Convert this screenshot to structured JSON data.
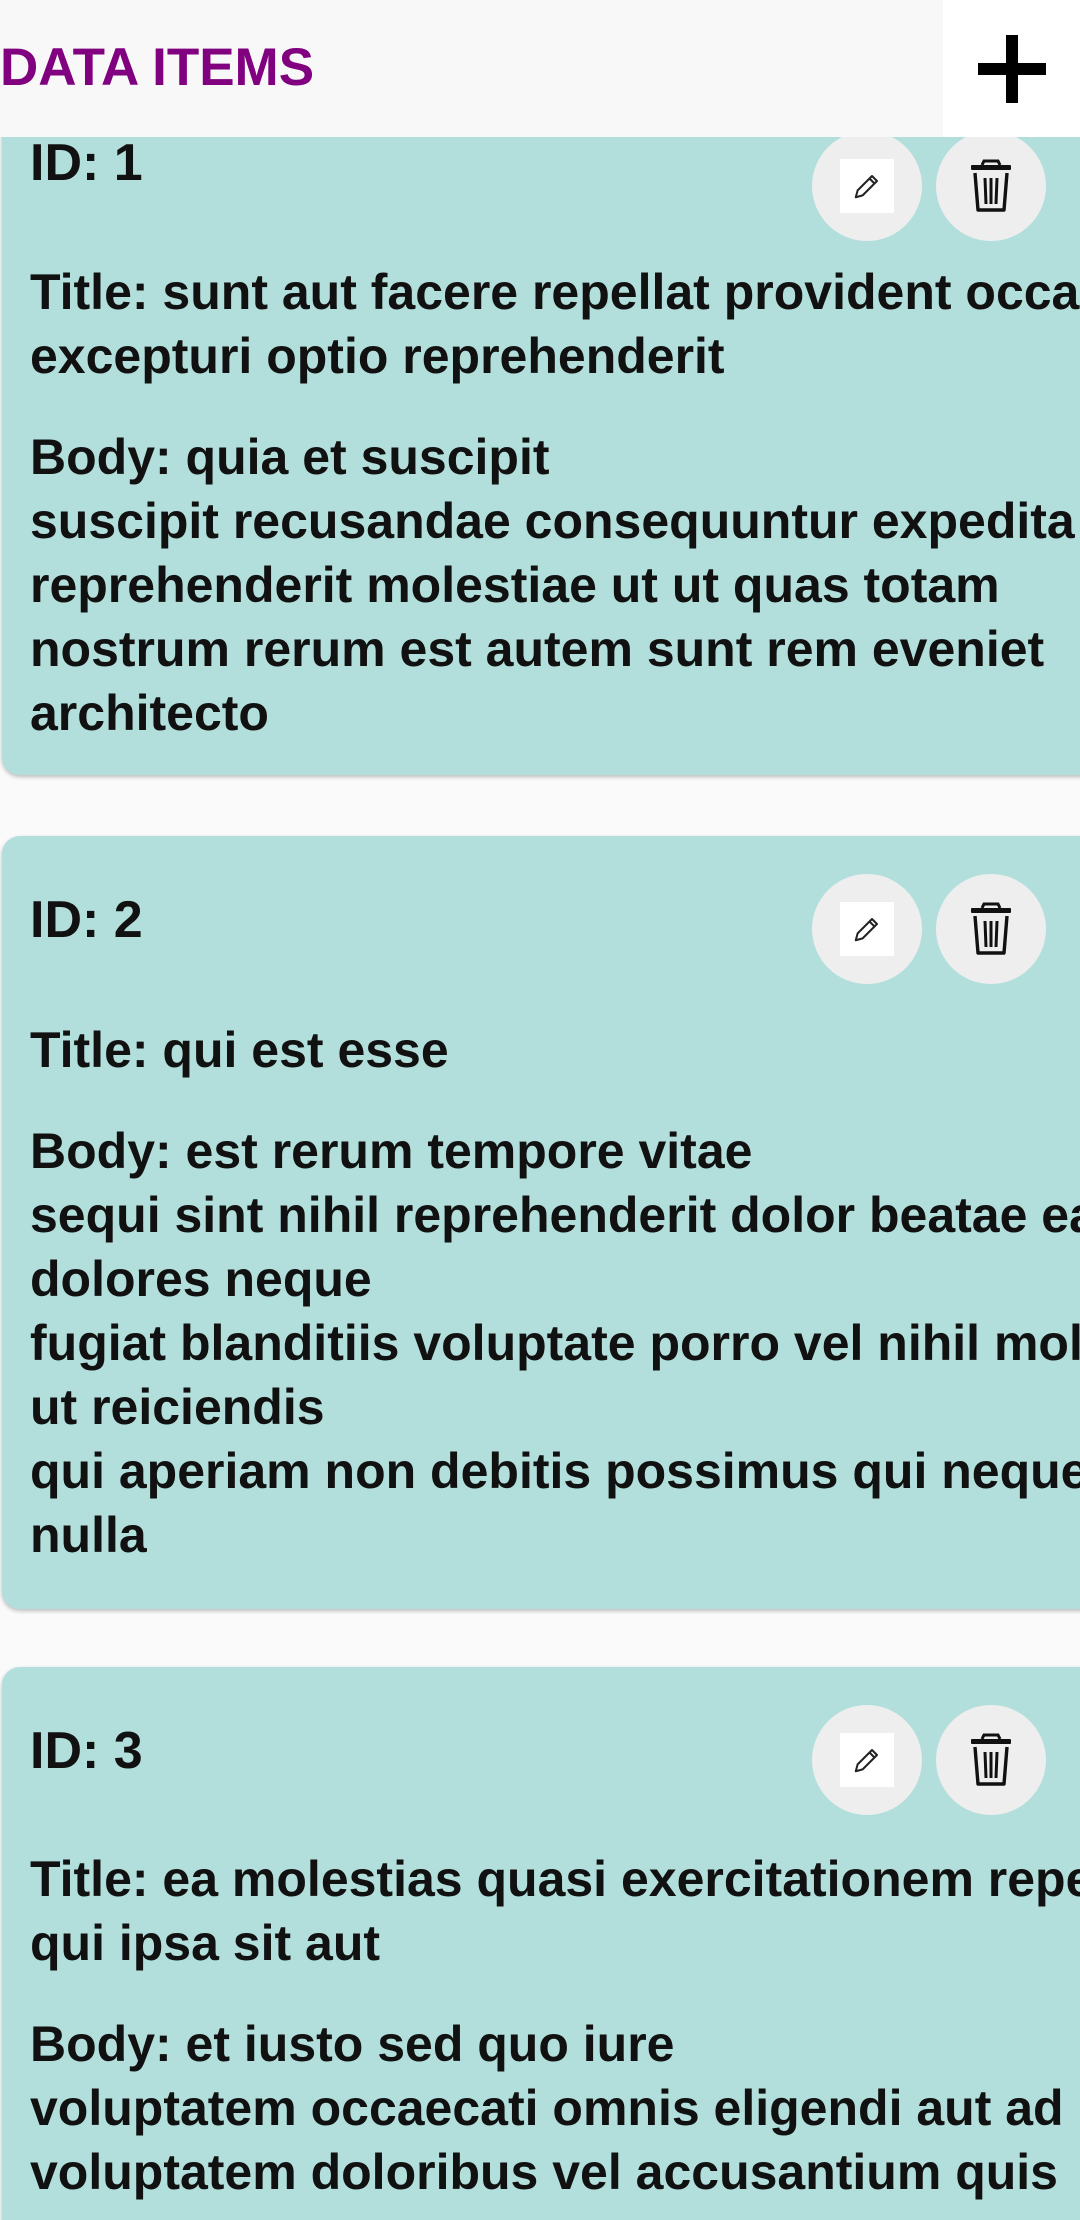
{
  "header": {
    "title": "DATA ITEMS"
  },
  "items": [
    {
      "id_label": "ID: 1",
      "title_label": "Title: sunt aut facere repellat provident occaecati\nexcepturi optio reprehenderit",
      "body_label": "Body: quia et suscipit\nsuscipit recusandae consequuntur expedita et cum\nreprehenderit molestiae ut ut quas totam\nnostrum rerum est autem sunt rem eveniet\narchitecto"
    },
    {
      "id_label": "ID: 2",
      "title_label": "Title: qui est esse",
      "body_label": "Body: est rerum tempore vitae\nsequi sint nihil reprehenderit dolor beatae ea\ndolores neque\nfugiat blanditiis voluptate porro vel nihil molestiae\nut reiciendis\nqui aperiam non debitis possimus qui neque nisi\nnulla"
    },
    {
      "id_label": "ID: 3",
      "title_label": "Title: ea molestias quasi exercitationem repellat\nqui ipsa sit aut",
      "body_label": "Body: et iusto sed quo iure\nvoluptatem occaecati omnis eligendi aut ad\nvoluptatem doloribus vel accusantium quis"
    }
  ],
  "icons": {
    "add": "plus-icon",
    "edit": "pencil-icon",
    "delete": "trash-icon"
  },
  "colors": {
    "title": "#800080",
    "card_background": "#b2dfdb",
    "button_background": "#eeeeee",
    "page_background": "#fafafa"
  }
}
